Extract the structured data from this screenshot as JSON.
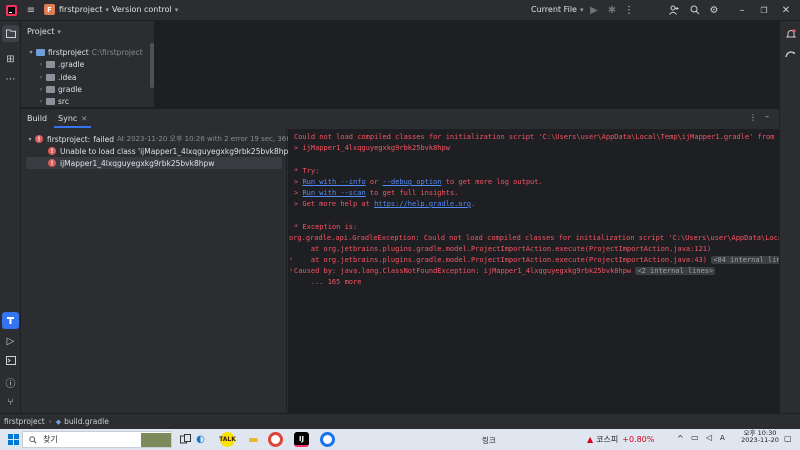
{
  "titlebar": {
    "project_badge": "F",
    "project_name": "firstproject",
    "vcs": "Version control",
    "run_config": "Current File",
    "icons": [
      "app-logo-icon",
      "hamburger-menu-icon",
      "run-icon",
      "debug-icon",
      "more-icon",
      "add-user-icon",
      "search-icon",
      "settings-icon",
      "minimize-icon",
      "restore-icon",
      "close-icon"
    ]
  },
  "project_panel": {
    "title": "Project",
    "root": {
      "name": "firstproject",
      "path": "C:\\firstproject"
    },
    "items": [
      ".gradle",
      ".idea",
      "gradle",
      "src"
    ]
  },
  "build_panel": {
    "tabs": [
      "Build",
      "Sync"
    ],
    "tree": {
      "root_label": "firstproject:",
      "root_status": "failed",
      "root_meta": "At 2023-11-20 오후 10:26 with 2 error 19 sec, 366 ms",
      "children": [
        "Unable to load class 'ijMapper1_4lxqguyegxkg9rbk25bvk8hpw'",
        "ijMapper1_4lxqguyegxkg9rbk25bvk8hpw"
      ]
    },
    "console": {
      "l1": "Could not load compiled classes for initialization script 'C:\\Users\\user\\AppData\\Local\\Temp\\ijMapper1.gradle' from cache.",
      "l2": "> ijMapper1_4lxqguyegxkg9rbk25bvk8hpw",
      "l3": "* Try:",
      "l4_a": "> ",
      "l4_link1": "Run with --info",
      "l4_b": " or ",
      "l4_link2": "--debug option",
      "l4_c": " to get more log output.",
      "l5_a": "> ",
      "l5_link": "Run with --scan",
      "l5_b": " to get full insights.",
      "l6_a": "> Get more help at ",
      "l6_link": "https://help.gradle.org",
      "l6_b": ".",
      "l7": "* Exception is:",
      "l8": "org.gradle.api.GradleException: Could not load compiled classes for initialization script 'C:\\Users\\user\\AppData\\Local\\Temp",
      "l9": "    at org.jetbrains.plugins.gradle.model.ProjectImportAction.execute(ProjectImportAction.java:121)",
      "l10": "    at org.jetbrains.plugins.gradle.model.ProjectImportAction.execute(ProjectImportAction.java:43)",
      "l10_tag": "<84 internal lines>",
      "l11": "Caused by: java.lang.ClassNotFoundException: ijMapper1_4lxqguyegxkg9rbk25bvk8hpw",
      "l11_tag": "<2 internal lines>",
      "l12": "    ... 165 more"
    }
  },
  "statusbar": {
    "crumb1": "firstproject",
    "crumb2": "build.gradle"
  },
  "taskbar": {
    "search": "찾기",
    "right_label": "링크",
    "stock_name": "코스피",
    "stock_change": "+0.80%",
    "time_ampm": "오후",
    "time": "10:30",
    "date": "2023-11-20",
    "accent_positive": "#d8001c"
  }
}
